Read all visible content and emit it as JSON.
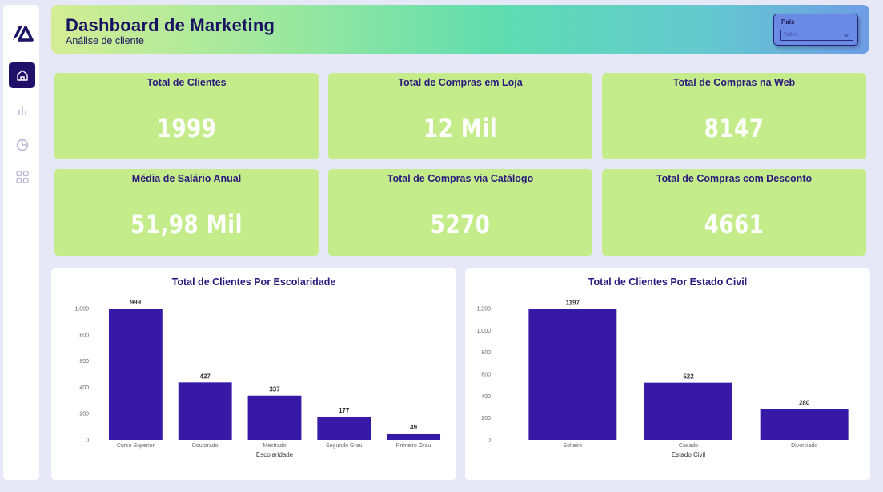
{
  "header": {
    "title": "Dashboard de Marketing",
    "subtitle": "Análise de cliente"
  },
  "filter": {
    "label": "País",
    "value": "Todos"
  },
  "sidebar": {
    "items": [
      {
        "icon": "home-icon",
        "active": true
      },
      {
        "icon": "bar-chart-icon",
        "active": false
      },
      {
        "icon": "pie-chart-icon",
        "active": false
      },
      {
        "icon": "grid-icon",
        "active": false
      }
    ]
  },
  "kpis": [
    {
      "title": "Total de Clientes",
      "value": "1999"
    },
    {
      "title": "Total de Compras em Loja",
      "value": "12 Mil"
    },
    {
      "title": "Total de Compras na Web",
      "value": "8147"
    },
    {
      "title": "Média de Salário Anual",
      "value": "51,98 Mil"
    },
    {
      "title": "Total de Compras via Catálogo",
      "value": "5270"
    },
    {
      "title": "Total de Compras com Desconto",
      "value": "4661"
    }
  ],
  "colors": {
    "bar": "#3719a8",
    "kpi_bg": "#c4ec8a",
    "title": "#2a1a7e"
  },
  "chart_data": [
    {
      "type": "bar",
      "title": "Total de Clientes Por Escolaridade",
      "xlabel": "Escolaridade",
      "ylabel": "",
      "categories": [
        "Curso Superior",
        "Doutorado",
        "Mestrado",
        "Segundo Grau",
        "Primeiro Grau"
      ],
      "values": [
        999,
        437,
        337,
        177,
        49
      ],
      "ylim": [
        0,
        1000
      ],
      "yticks": [
        "0",
        "200",
        "400",
        "600",
        "800",
        "1.000"
      ],
      "ytick_values": [
        0,
        200,
        400,
        600,
        800,
        1000
      ],
      "grid": false
    },
    {
      "type": "bar",
      "title": "Total de Clientes Por Estado Civil",
      "xlabel": "Estado Civil",
      "ylabel": "",
      "categories": [
        "Solteiro",
        "Casado",
        "Divorciado"
      ],
      "values": [
        1197,
        522,
        280
      ],
      "ylim": [
        0,
        1200
      ],
      "yticks": [
        "0",
        "200",
        "400",
        "600",
        "800",
        "1.000",
        "1.200"
      ],
      "ytick_values": [
        0,
        200,
        400,
        600,
        800,
        1000,
        1200
      ],
      "grid": false
    }
  ]
}
